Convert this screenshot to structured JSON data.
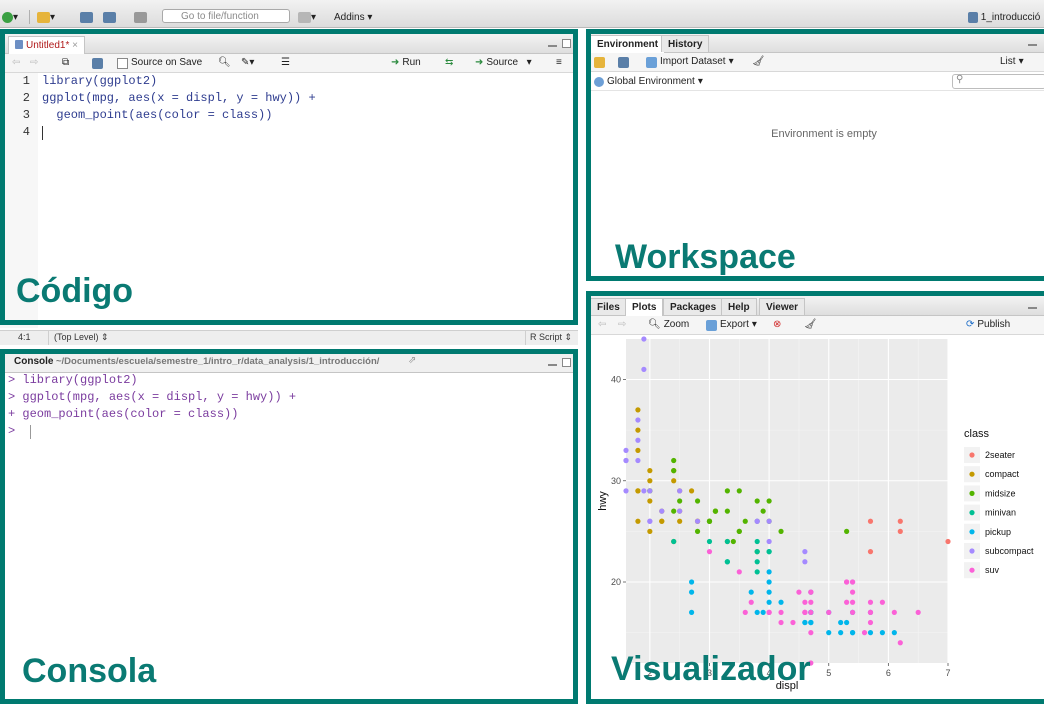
{
  "toolbar": {
    "goto_placeholder": "Go to file/function",
    "addins_label": "Addins",
    "project_label": "1_introducció"
  },
  "editor": {
    "tab_label": "Untitled1*",
    "source_on_save": "Source on Save",
    "run_label": "Run",
    "source_label": "Source",
    "lines": [
      {
        "num": "1",
        "text": "library(ggplot2)"
      },
      {
        "num": "2",
        "text": "ggplot(mpg, aes(x = displ, y = hwy)) +"
      },
      {
        "num": "3",
        "text": "  geom_point(aes(color = class))"
      },
      {
        "num": "4",
        "text": ""
      }
    ],
    "status_pos": "4:1",
    "status_scope": "(Top Level)",
    "status_type": "R Script"
  },
  "console": {
    "tab_label": "Console",
    "path": "~/Documents/escuela/semestre_1/intro_r/data_analysis/1_introducción/",
    "lines": [
      "> library(ggplot2)",
      "> ggplot(mpg, aes(x = displ, y = hwy)) +",
      "+ geom_point(aes(color = class))",
      ">"
    ]
  },
  "workspace": {
    "tabs": [
      "Environment",
      "History"
    ],
    "import_label": "Import Dataset",
    "list_label": "List",
    "env_label": "Global Environment",
    "empty_text": "Environment is empty"
  },
  "viewer": {
    "tabs": [
      "Files",
      "Plots",
      "Packages",
      "Help",
      "Viewer"
    ],
    "zoom_label": "Zoom",
    "export_label": "Export",
    "publish_label": "Publish"
  },
  "annotations": {
    "codigo": "Código",
    "workspace": "Workspace",
    "consola": "Consola",
    "visualizador": "Visualizador"
  },
  "colors": {
    "frame": "#007a70",
    "annotation": "#0a7a73",
    "panel_bg": "#ebebeb"
  },
  "chart_data": {
    "type": "scatter",
    "xlabel": "displ",
    "ylabel": "hwy",
    "xlim": [
      1.6,
      7.0
    ],
    "ylim": [
      12,
      44
    ],
    "xticks": [
      2,
      3,
      4,
      5,
      6,
      7
    ],
    "yticks": [
      20,
      30,
      40
    ],
    "legend_title": "class",
    "legend_position": "right",
    "series": [
      {
        "name": "2seater",
        "color": "#f8766d",
        "points": [
          [
            5.7,
            26
          ],
          [
            5.7,
            23
          ],
          [
            6.2,
            26
          ],
          [
            6.2,
            25
          ],
          [
            7.0,
            24
          ]
        ]
      },
      {
        "name": "compact",
        "color": "#c49a00",
        "points": [
          [
            1.8,
            29
          ],
          [
            1.8,
            29
          ],
          [
            2.0,
            31
          ],
          [
            2.0,
            30
          ],
          [
            2.8,
            26
          ],
          [
            2.8,
            26
          ],
          [
            3.1,
            27
          ],
          [
            1.8,
            26
          ],
          [
            2.0,
            25
          ],
          [
            2.0,
            28
          ],
          [
            2.2,
            27
          ],
          [
            2.5,
            29
          ],
          [
            2.5,
            27
          ],
          [
            2.2,
            26
          ],
          [
            2.2,
            26
          ],
          [
            2.4,
            31
          ],
          [
            2.4,
            30
          ],
          [
            3.0,
            26
          ],
          [
            2.4,
            24
          ],
          [
            3.3,
            24
          ],
          [
            2.5,
            26
          ],
          [
            2.7,
            29
          ],
          [
            1.8,
            37
          ],
          [
            1.8,
            35
          ],
          [
            1.8,
            33
          ]
        ]
      },
      {
        "name": "midsize",
        "color": "#53b400",
        "points": [
          [
            2.4,
            27
          ],
          [
            3.0,
            26
          ],
          [
            3.1,
            27
          ],
          [
            2.8,
            25
          ],
          [
            3.1,
            27
          ],
          [
            3.5,
            25
          ],
          [
            3.6,
            26
          ],
          [
            2.5,
            28
          ],
          [
            3.3,
            29
          ],
          [
            3.3,
            27
          ],
          [
            2.4,
            31
          ],
          [
            2.4,
            32
          ],
          [
            3.0,
            26
          ],
          [
            3.5,
            29
          ],
          [
            3.8,
            26
          ],
          [
            3.9,
            27
          ],
          [
            4.0,
            28
          ],
          [
            3.5,
            25
          ],
          [
            3.8,
            23
          ],
          [
            2.0,
            29
          ],
          [
            2.0,
            29
          ],
          [
            2.8,
            28
          ],
          [
            4.2,
            25
          ],
          [
            5.3,
            25
          ],
          [
            3.4,
            24
          ],
          [
            3.0,
            26
          ],
          [
            3.8,
            28
          ],
          [
            4.0,
            26
          ]
        ]
      },
      {
        "name": "minivan",
        "color": "#00c094",
        "points": [
          [
            2.4,
            24
          ],
          [
            3.0,
            24
          ],
          [
            3.3,
            22
          ],
          [
            3.3,
            22
          ],
          [
            3.8,
            23
          ],
          [
            3.8,
            22
          ],
          [
            3.8,
            21
          ],
          [
            4.0,
            23
          ],
          [
            3.3,
            24
          ],
          [
            3.8,
            24
          ],
          [
            4.0,
            23
          ]
        ]
      },
      {
        "name": "pickup",
        "color": "#00b6eb",
        "points": [
          [
            2.7,
            20
          ],
          [
            2.7,
            19
          ],
          [
            2.7,
            17
          ],
          [
            3.7,
            19
          ],
          [
            3.9,
            17
          ],
          [
            4.7,
            17
          ],
          [
            4.7,
            17
          ],
          [
            5.2,
            16
          ],
          [
            5.2,
            15
          ],
          [
            5.7,
            15
          ],
          [
            5.9,
            15
          ],
          [
            4.7,
            16
          ],
          [
            5.7,
            17
          ],
          [
            6.1,
            15
          ],
          [
            4.0,
            19
          ],
          [
            4.0,
            18
          ],
          [
            4.7,
            16
          ],
          [
            5.4,
            15
          ],
          [
            5.4,
            15
          ],
          [
            4.2,
            18
          ],
          [
            4.6,
            16
          ],
          [
            5.4,
            17
          ],
          [
            4.7,
            17
          ],
          [
            3.8,
            17
          ],
          [
            4.0,
            20
          ],
          [
            4.6,
            16
          ],
          [
            5.3,
            16
          ],
          [
            5.0,
            17
          ],
          [
            5.0,
            15
          ],
          [
            4.7,
            16
          ],
          [
            4.7,
            19
          ],
          [
            4.0,
            21
          ]
        ]
      },
      {
        "name": "subcompact",
        "color": "#a58aff",
        "points": [
          [
            1.6,
            33
          ],
          [
            1.6,
            32
          ],
          [
            1.6,
            32
          ],
          [
            1.6,
            29
          ],
          [
            1.8,
            32
          ],
          [
            1.8,
            34
          ],
          [
            1.8,
            36
          ],
          [
            1.9,
            44
          ],
          [
            1.9,
            41
          ],
          [
            2.0,
            29
          ],
          [
            2.0,
            26
          ],
          [
            2.5,
            29
          ],
          [
            2.5,
            27
          ],
          [
            2.2,
            27
          ],
          [
            2.0,
            26
          ],
          [
            2.8,
            26
          ],
          [
            3.8,
            26
          ],
          [
            4.6,
            23
          ],
          [
            4.6,
            22
          ],
          [
            4.0,
            26
          ],
          [
            4.0,
            24
          ],
          [
            5.4,
            20
          ],
          [
            3.8,
            26
          ],
          [
            1.9,
            29
          ]
        ]
      },
      {
        "name": "suv",
        "color": "#fb61d7",
        "points": [
          [
            5.7,
            18
          ],
          [
            5.3,
            20
          ],
          [
            5.7,
            17
          ],
          [
            6.5,
            17
          ],
          [
            4.7,
            17
          ],
          [
            4.7,
            19
          ],
          [
            4.7,
            18
          ],
          [
            5.3,
            20
          ],
          [
            5.3,
            18
          ],
          [
            5.7,
            17
          ],
          [
            5.9,
            18
          ],
          [
            4.2,
            17
          ],
          [
            4.4,
            16
          ],
          [
            4.6,
            17
          ],
          [
            5.4,
            18
          ],
          [
            5.4,
            17
          ],
          [
            5.4,
            20
          ],
          [
            6.1,
            17
          ],
          [
            4.6,
            17
          ],
          [
            5.0,
            17
          ],
          [
            5.6,
            15
          ],
          [
            6.2,
            14
          ],
          [
            4.7,
            15
          ],
          [
            4.7,
            12
          ],
          [
            3.0,
            23
          ],
          [
            4.0,
            17
          ],
          [
            5.4,
            19
          ],
          [
            4.6,
            18
          ],
          [
            4.7,
            19
          ],
          [
            3.7,
            18
          ],
          [
            4.2,
            16
          ],
          [
            4.6,
            17
          ],
          [
            5.7,
            16
          ],
          [
            3.6,
            17
          ],
          [
            4.0,
            17
          ],
          [
            4.0,
            17
          ],
          [
            3.5,
            21
          ],
          [
            4.5,
            19
          ]
        ]
      }
    ]
  }
}
